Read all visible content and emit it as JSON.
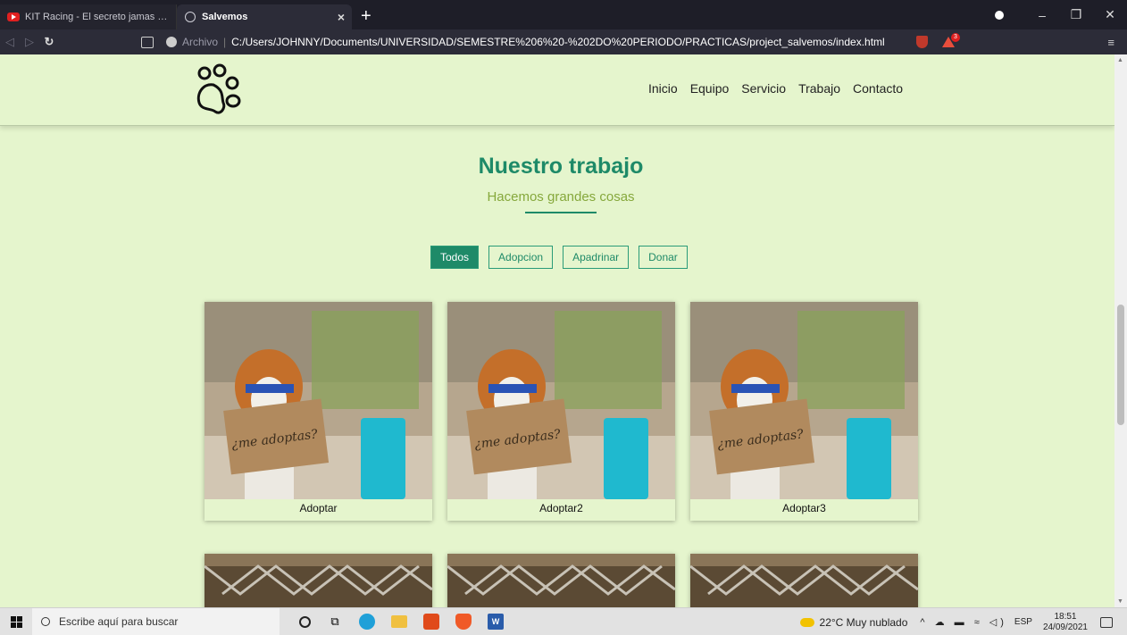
{
  "browser": {
    "tabs": [
      {
        "title": "KIT Racing - El secreto jamas contado",
        "active": false,
        "icon": "youtube-icon"
      },
      {
        "title": "Salvemos",
        "active": true,
        "icon": "globe-icon"
      }
    ],
    "new_tab": "+",
    "close_tab": "×",
    "address": {
      "label": "Archivo",
      "separator": "|",
      "path": "C:/Users/JOHNNY/Documents/UNIVERSIDAD/SEMESTRE%206%20-%202DO%20PERIODO/PRACTICAS/project_salvemos/index.html"
    },
    "window_controls": {
      "minimize": "–",
      "maximize": "❐",
      "close": "✕"
    },
    "menu_icon": "≡",
    "notification_count": "3"
  },
  "site": {
    "nav": [
      {
        "label": "Inicio"
      },
      {
        "label": "Equipo"
      },
      {
        "label": "Servicio"
      },
      {
        "label": "Trabajo"
      },
      {
        "label": "Contacto"
      }
    ],
    "section": {
      "title": "Nuestro trabajo",
      "subtitle": "Hacemos grandes cosas"
    },
    "filters": [
      {
        "label": "Todos",
        "active": true
      },
      {
        "label": "Adopcion",
        "active": false
      },
      {
        "label": "Apadrinar",
        "active": false
      },
      {
        "label": "Donar",
        "active": false
      }
    ],
    "cards": [
      {
        "caption": "Adoptar",
        "sign": "¿me adoptas?"
      },
      {
        "caption": "Adoptar2",
        "sign": "¿me adoptas?"
      },
      {
        "caption": "Adoptar3",
        "sign": "¿me adoptas?"
      }
    ],
    "colors": {
      "background": "#e5f5cd",
      "accent": "#1e8a68",
      "subtitle": "#86a83c"
    }
  },
  "taskbar": {
    "search_placeholder": "Escribe aquí para buscar",
    "weather": "22°C  Muy nublado",
    "tray_icons": "^ ☁ ▬ ≈ ◁)",
    "language": "ESP",
    "time": "18:51",
    "date": "24/09/2021"
  }
}
